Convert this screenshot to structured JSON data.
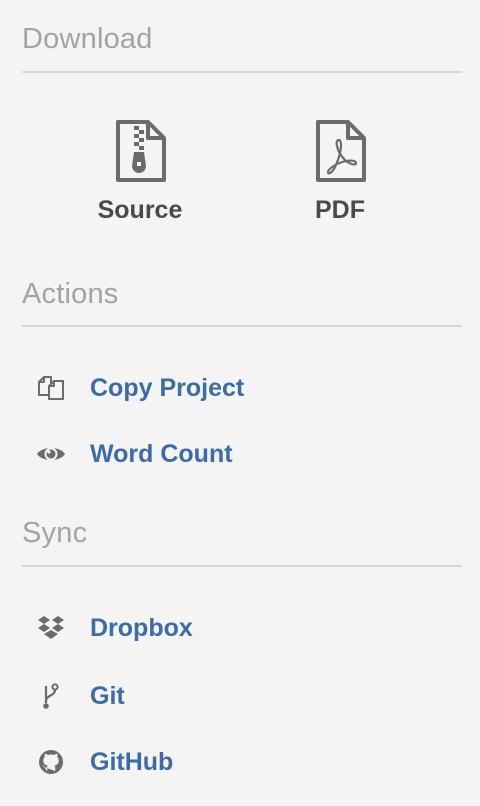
{
  "download": {
    "title": "Download",
    "items": [
      {
        "label": "Source",
        "icon": "zip-file-icon"
      },
      {
        "label": "PDF",
        "icon": "pdf-file-icon"
      }
    ]
  },
  "actions": {
    "title": "Actions",
    "items": [
      {
        "label": "Copy Project",
        "icon": "copy-icon"
      },
      {
        "label": "Word Count",
        "icon": "eye-icon"
      }
    ]
  },
  "sync": {
    "title": "Sync",
    "items": [
      {
        "label": "Dropbox",
        "icon": "dropbox-icon"
      },
      {
        "label": "Git",
        "icon": "git-branch-icon"
      },
      {
        "label": "GitHub",
        "icon": "github-icon"
      }
    ]
  },
  "colors": {
    "background": "#f4f4f4",
    "section_title": "#a3a3a3",
    "divider": "#d6d6d6",
    "link": "#3d6aa9",
    "download_label": "#4a4a4a",
    "icon": "#6b6b6b"
  }
}
